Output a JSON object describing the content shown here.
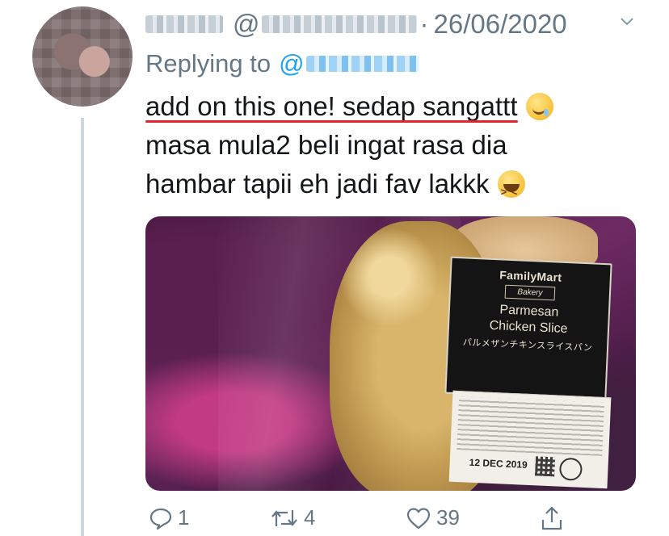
{
  "tweet": {
    "author_name": "",
    "author_handle": "",
    "separator": "·",
    "date": "26/06/2020",
    "reply_label": "Replying to",
    "reply_at": "@",
    "text_line_1": "add on this one! sedap sangattt",
    "text_line_2": "masa mula2 beli ingat rasa dia",
    "text_line_3": "hambar tapii eh jadi fav lakkk",
    "emoji_1": "drooling-face-icon",
    "emoji_2": "laughing-face-icon"
  },
  "image": {
    "brand": "FamilyMart",
    "sub_brand": "Bakery",
    "product_line_1": "Parmesan",
    "product_line_2": "Chicken Slice",
    "product_jp": "パルメザンチキンスライスパン",
    "date_stamp": "12 DEC 2019"
  },
  "actions": {
    "replies": "1",
    "retweets": "4",
    "likes": "39"
  },
  "colors": {
    "text_primary": "#14171a",
    "text_secondary": "#657786",
    "link": "#1da1f2",
    "underline_annotation": "#e0252f",
    "thread_line": "#cdd6dd"
  }
}
